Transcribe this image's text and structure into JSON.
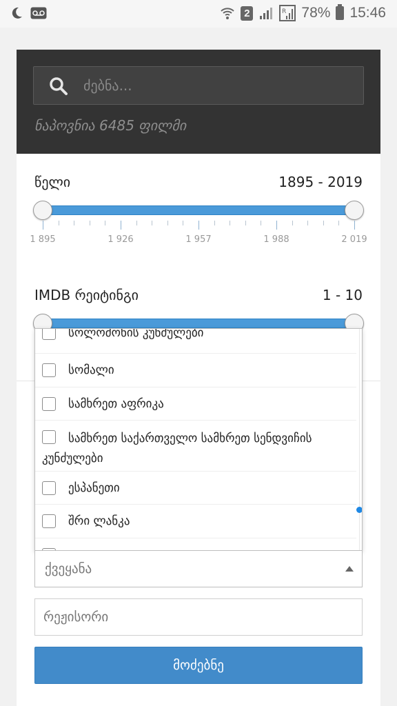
{
  "status_bar": {
    "battery": "78%",
    "time": "15:46",
    "sim": "2",
    "icons": [
      "moon-icon",
      "voicemail-icon",
      "wifi-icon",
      "signal-icon",
      "signal-roaming-icon",
      "battery-icon"
    ]
  },
  "search": {
    "placeholder": "ძებნა...",
    "found_text": "ნაპოვნია 6485 ფილმი"
  },
  "year_filter": {
    "label": "წელი",
    "range_text": "1895 - 2019",
    "min": 1895,
    "max": 2019,
    "selected_from": 1895,
    "selected_to": 2019,
    "tick_labels": [
      "1 895",
      "1 926",
      "1 957",
      "1 988",
      "2 019"
    ]
  },
  "imdb_filter": {
    "label": "IMDB რეიტინგი",
    "range_text": "1 - 10",
    "min": 1,
    "max": 10,
    "selected_from": 1,
    "selected_to": 10
  },
  "country_dropdown": {
    "items": [
      "სოლომონის კუნძულები",
      "სომალი",
      "სამხრეთ აფრიკა",
      "სამხრეთ საქართველო სამხრეთ სენდვიჩის კუნძულები",
      "ესპანეთი",
      "შრი ლანკა"
    ],
    "placeholder": "ქვეყანა"
  },
  "director": {
    "placeholder": "რეჟისორი"
  },
  "submit": {
    "label": "მოძებნე"
  },
  "colors": {
    "accent": "#428bca",
    "header_bg": "#333333",
    "slider": "#4a9ad9"
  }
}
